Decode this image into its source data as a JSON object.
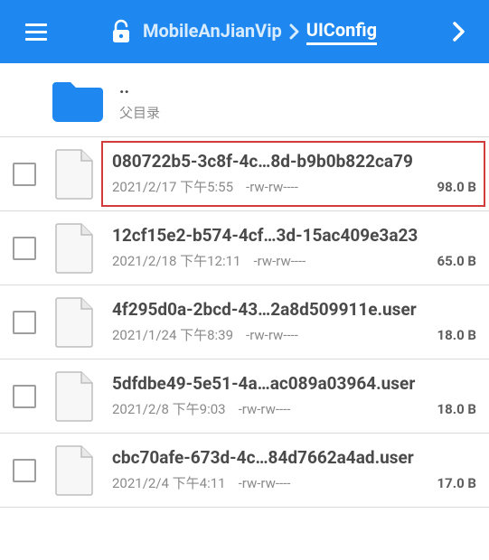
{
  "header": {
    "breadcrumb": {
      "parent": "MobileAnJianVip",
      "current": "UIConfig"
    }
  },
  "parent_row": {
    "name": "..",
    "label": "父目录"
  },
  "files": [
    {
      "name": "080722b5-3c8f-4c…8d-b9b0b822ca79",
      "date": "2021/2/17 下午5:55",
      "perm": "-rw-rw----",
      "size": "98.0 B",
      "highlighted": true
    },
    {
      "name": "12cf15e2-b574-4cf…3d-15ac409e3a23",
      "date": "2021/2/18 下午12:11",
      "perm": "-rw-rw----",
      "size": "65.0 B",
      "highlighted": false
    },
    {
      "name": "4f295d0a-2bcd-43…2a8d509911e.user",
      "date": "2021/1/24 下午8:39",
      "perm": "-rw-rw----",
      "size": "18.0 B",
      "highlighted": false
    },
    {
      "name": "5dfdbe49-5e51-4a…ac089a03964.user",
      "date": "2021/2/8 下午9:03",
      "perm": "-rw-rw----",
      "size": "18.0 B",
      "highlighted": false
    },
    {
      "name": "cbc70afe-673d-4c…84d7662a4ad.user",
      "date": "2021/2/4 下午4:11",
      "perm": "-rw-rw----",
      "size": "17.0 B",
      "highlighted": false
    }
  ]
}
